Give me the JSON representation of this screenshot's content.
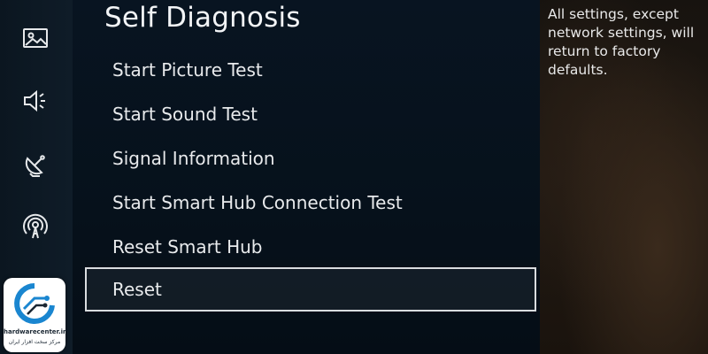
{
  "panel": {
    "title": "Self Diagnosis",
    "items": [
      {
        "label": "Start Picture Test",
        "selected": false
      },
      {
        "label": "Start Sound Test",
        "selected": false
      },
      {
        "label": "Signal Information",
        "selected": false
      },
      {
        "label": "Start Smart Hub Connection Test",
        "selected": false
      },
      {
        "label": "Reset Smart Hub",
        "selected": false
      },
      {
        "label": "Reset",
        "selected": true
      }
    ]
  },
  "description": {
    "text": "All settings, except network settings, will return to factory defaults."
  },
  "rail": {
    "icons": [
      "picture-icon",
      "sound-icon",
      "broadcasting-icon",
      "network-icon",
      "general-icon"
    ]
  },
  "watermark": {
    "name": "hardwarecenter.ir",
    "subtitle": "مرکز سخت افزار ایران"
  },
  "colors": {
    "accent_logo": "#1a86d0",
    "selection_border": "#d9dcdf",
    "text": "#e8eaec"
  }
}
